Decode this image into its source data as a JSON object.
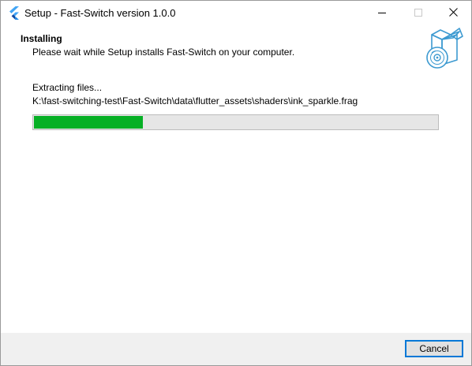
{
  "window": {
    "title": "Setup - Fast-Switch version 1.0.0",
    "app_icon": "flutter-logo-icon",
    "controls": {
      "minimize_icon": "minimize-icon",
      "maximize_icon": "maximize-icon",
      "close_icon": "close-icon"
    }
  },
  "header": {
    "title": "Installing",
    "subtitle": "Please wait while Setup installs Fast-Switch on your computer.",
    "image_icon": "installer-box-disc-icon"
  },
  "main": {
    "status": "Extracting files...",
    "current_file": "K:\\fast-switching-test\\Fast-Switch\\data\\flutter_assets\\shaders\\ink_sparkle.frag",
    "progress": 0.27
  },
  "footer": {
    "cancel_label": "Cancel"
  },
  "colors": {
    "progress_fill": "#06b025",
    "progress_track": "#e6e6e6",
    "footer_bg": "#f0f0f0",
    "accent": "#0078d7",
    "icon_blue": "#3d9ad1"
  }
}
